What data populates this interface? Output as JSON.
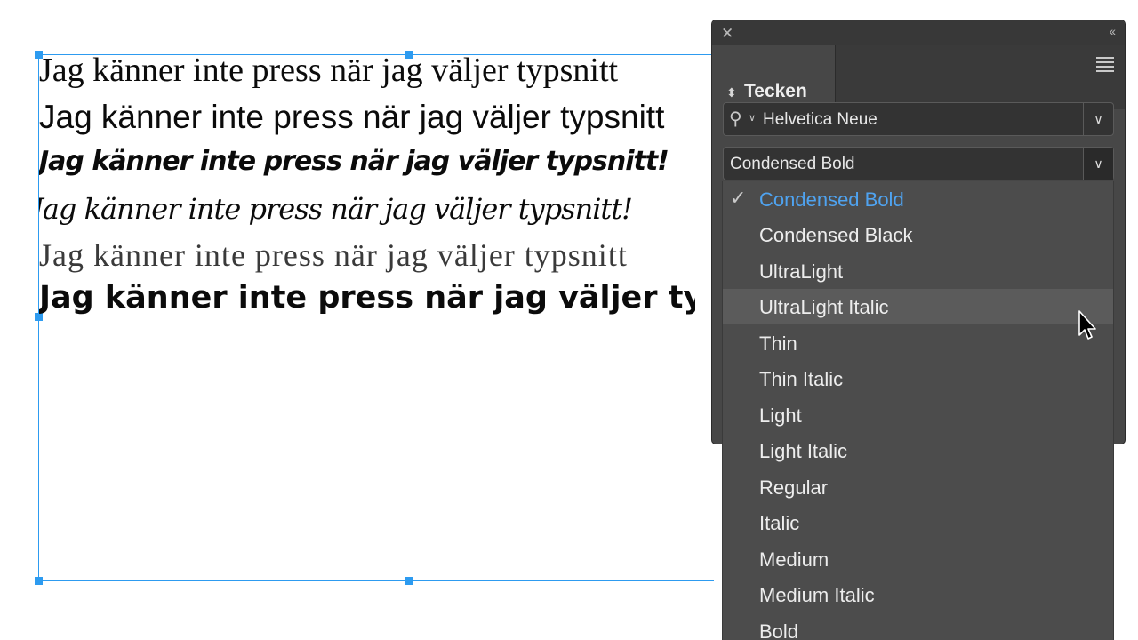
{
  "document": {
    "sample_lines": [
      "Jag känner inte press när jag väljer typsnitt",
      "Jag känner inte press när jag väljer typsnitt",
      "Jag känner inte press när jag väljer typsnitt!",
      "Jag känner inte press när jag väljer typsnitt!",
      "Jag känner inte press när jag väljer typsnitt",
      "Jag känner inte press när jag väljer typsnitt"
    ]
  },
  "panel": {
    "tab_label": "Tecken",
    "font_family": "Helvetica Neue",
    "font_style": "Condensed Bold"
  },
  "dropdown": {
    "options": [
      "Condensed Bold",
      "Condensed Black",
      "UltraLight",
      "UltraLight Italic",
      "Thin",
      "Thin Italic",
      "Light",
      "Light Italic",
      "Regular",
      "Italic",
      "Medium",
      "Medium Italic",
      "Bold"
    ],
    "selected_index": 0,
    "hover_index": 3
  },
  "colors": {
    "selection_blue": "#2d9bf0",
    "selected_option": "#4fa3f0",
    "panel_bg": "#474747"
  }
}
